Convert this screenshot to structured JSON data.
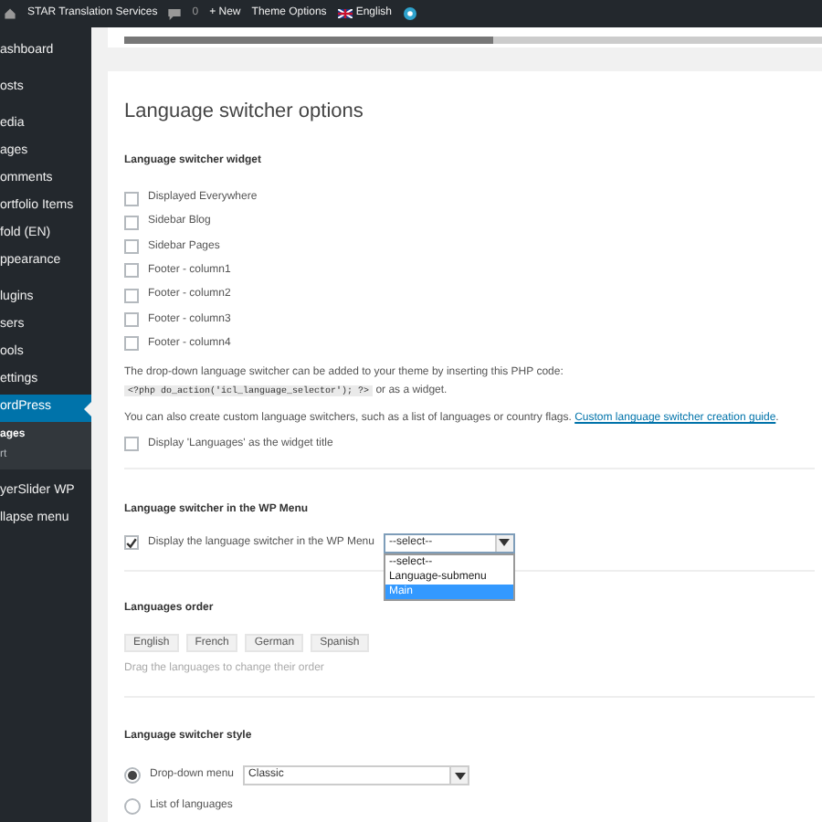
{
  "admin_bar": {
    "site": "STAR Translation Services",
    "comments": "0",
    "new": "+ New",
    "theme_options": "Theme Options",
    "language": "English"
  },
  "sidebar": {
    "items": [
      {
        "label": "ashboard",
        "selected": false
      },
      {
        "label": "osts",
        "selected": false
      },
      {
        "label": "edia",
        "selected": false
      },
      {
        "label": "ages",
        "selected": false
      },
      {
        "label": "omments",
        "selected": false
      },
      {
        "label": "ortfolio Items",
        "selected": false
      },
      {
        "label": "fold (EN)",
        "selected": false
      },
      {
        "label": "ppearance",
        "selected": false
      },
      {
        "label": "lugins",
        "selected": false
      },
      {
        "label": "sers",
        "selected": false
      },
      {
        "label": "ools",
        "selected": false
      },
      {
        "label": "ettings",
        "selected": false
      },
      {
        "label": "ordPress",
        "selected": true,
        "children": [
          {
            "label": "ages",
            "selected": true
          },
          {
            "label": "rt",
            "selected": false
          }
        ]
      },
      {
        "label": "yerSlider WP",
        "selected": false
      },
      {
        "label": "llapse menu",
        "selected": false
      }
    ]
  },
  "progress": {
    "level": 0.53
  },
  "options": {
    "title": "Language switcher options",
    "widget": {
      "heading": "Language switcher widget",
      "areas": [
        {
          "label": "Displayed Everywhere",
          "checked": false
        },
        {
          "label": "Sidebar Blog",
          "checked": false
        },
        {
          "label": "Sidebar Pages",
          "checked": false
        },
        {
          "label": "Footer - column1",
          "checked": false
        },
        {
          "label": "Footer - column2",
          "checked": false
        },
        {
          "label": "Footer - column3",
          "checked": false
        },
        {
          "label": "Footer - column4",
          "checked": false
        }
      ],
      "php_text_before": "The drop-down language switcher can be added to your theme by inserting this PHP code:",
      "php_code": "<?php do_action('icl_language_selector'); ?>",
      "php_text_after": "or as a widget.",
      "custom_text": "You can also create custom language switchers, such as a list of languages or country flags.",
      "custom_link": "Custom language switcher creation guide",
      "custom_end": ".",
      "title_option": {
        "label": "Display 'Languages' as the widget title",
        "checked": false
      }
    },
    "wp_menu": {
      "heading": "Language switcher in the WP Menu",
      "option": {
        "label": "Display the language switcher in the WP Menu",
        "checked": true
      },
      "select_value": "--select--",
      "menu_options": [
        {
          "label": "--select--",
          "selected": false
        },
        {
          "label": "Language-submenu",
          "selected": false
        },
        {
          "label": "Main",
          "selected": true
        }
      ]
    },
    "order": {
      "heading": "Languages order",
      "languages": [
        "English",
        "French",
        "German",
        "Spanish"
      ],
      "hint": "Drag the languages to change their order"
    },
    "style": {
      "heading": "Language switcher style",
      "choices": [
        {
          "label": "Drop-down menu",
          "selected": true,
          "select_value": "Classic"
        },
        {
          "label": "List of languages",
          "selected": false
        }
      ]
    }
  }
}
